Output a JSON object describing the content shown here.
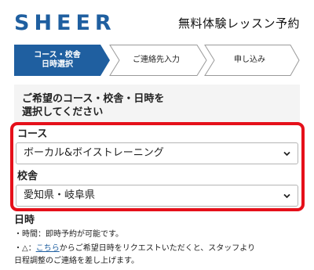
{
  "header": {
    "logo": "SHEER",
    "title": "無料体験レッスン予約"
  },
  "stepper": {
    "steps": [
      {
        "line1": "コース・校舎",
        "line2": "日時選択",
        "active": true
      },
      {
        "label": "ご連絡先入力",
        "active": false
      },
      {
        "label": "申し込み",
        "active": false
      }
    ]
  },
  "instruction": {
    "line1": "ご希望のコース・校舎・日時を",
    "line2": "選択してください"
  },
  "form": {
    "course_label": "コース",
    "course_value": "ボーカル&ボイストレーニング",
    "school_label": "校舎",
    "school_value": "愛知県・岐阜県"
  },
  "datetime": {
    "heading": "日時",
    "note1": "・時間：即時予約が可能です。",
    "note2_prefix": "・△：",
    "note2_link": "こちら",
    "note2_rest": "からご希望日時をリクエストいただくと、スタッフより",
    "note3": "日程調整のご連絡を差し上げます。"
  },
  "colors": {
    "brand": "#1f5fa0",
    "active_step": "#1f5fa0",
    "highlight": "#e5101a"
  }
}
